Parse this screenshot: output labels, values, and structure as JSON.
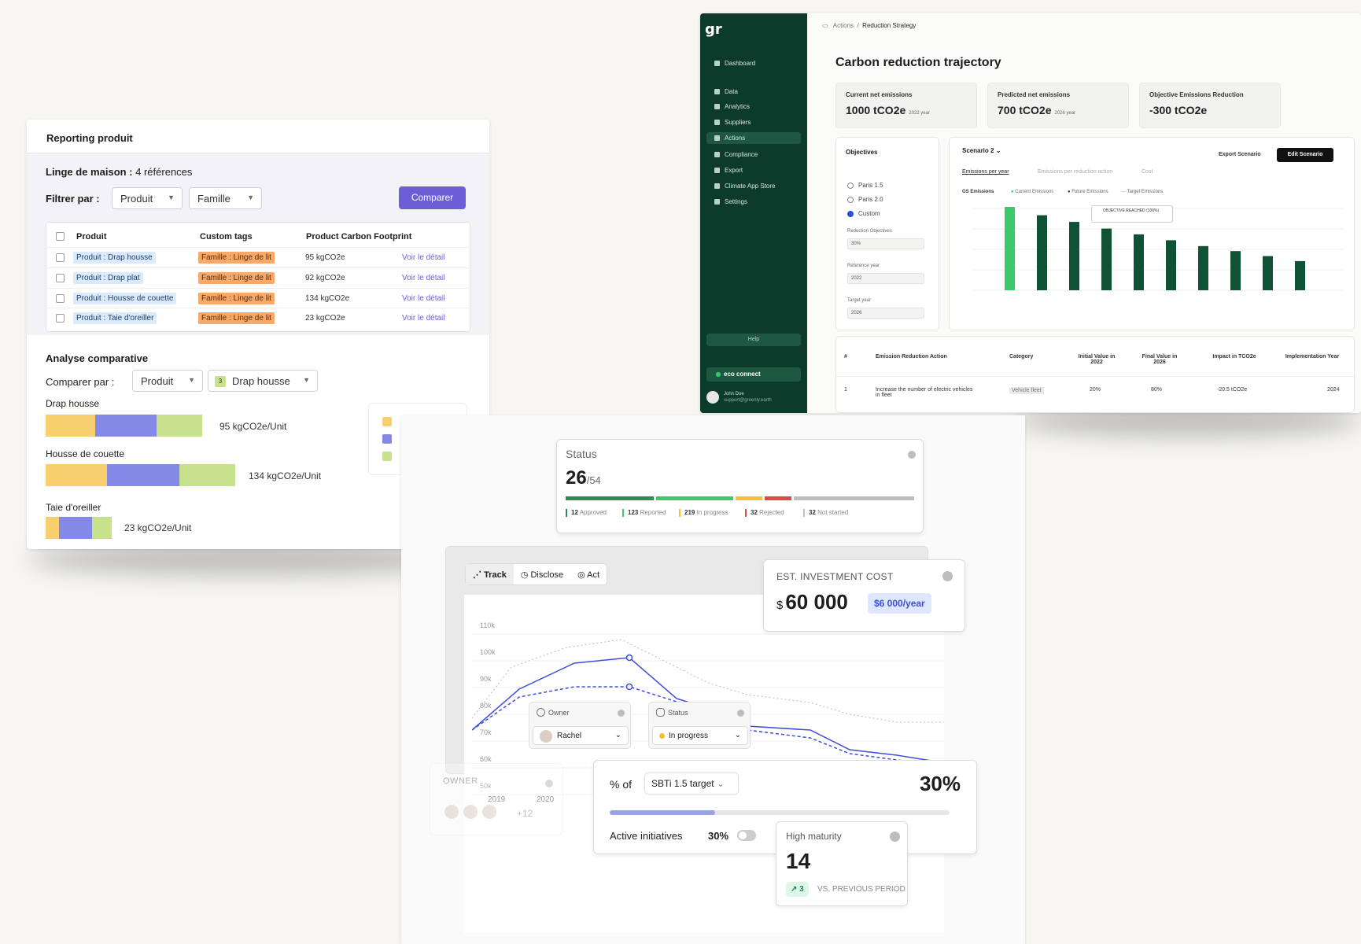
{
  "reporting": {
    "title": "Reporting produit",
    "category_label": "Linge de maison :",
    "category_count": "4 références",
    "filter_label": "Filtrer par :",
    "filter_product": "Produit",
    "filter_family": "Famille",
    "compare_button": "Comparer",
    "columns": [
      "Produit",
      "Custom tags",
      "Product Carbon Footprint"
    ],
    "rows": [
      {
        "product": "Produit : Drap housse",
        "tag": "Famille : Linge de lit",
        "footprint": "95 kgCO2e",
        "link": "Voir le détail"
      },
      {
        "product": "Produit : Drap plat",
        "tag": "Famille : Linge de lit",
        "footprint": "92 kgCO2e",
        "link": "Voir le détail"
      },
      {
        "product": "Produit : Housse de couette",
        "tag": "Famille : Linge de lit",
        "footprint": "134 kgCO2e",
        "link": "Voir le détail"
      },
      {
        "product": "Produit : Taie d'oreiller",
        "tag": "Famille : Linge de lit",
        "footprint": "23 kgCO2e",
        "link": "Voir le détail"
      }
    ],
    "analysis_title": "Analyse comparative",
    "compare_by_label": "Comparer par :",
    "compare_by_value": "Produit",
    "compare_item_badge": "3",
    "compare_item_value": "Drap housse",
    "bars": [
      {
        "label": "Drap housse",
        "value": "95 kgCO2e/Unit",
        "segments": [
          30,
          37,
          28
        ]
      },
      {
        "label": "Housse de couette",
        "value": "134 kgCO2e/Unit",
        "segments": [
          37,
          44,
          34
        ]
      },
      {
        "label": "Taie d'oreiller",
        "value": "23 kgCO2e/Unit",
        "segments": [
          8,
          20,
          12
        ]
      }
    ],
    "colors": {
      "yellow": "#f7cf6e",
      "blue": "#8389e4",
      "green": "#c7e18c",
      "purple": "#6c5ed6"
    }
  },
  "trajectory": {
    "breadcrumb": [
      "Actions",
      "/",
      "Reduction Strategy"
    ],
    "title": "Carbon reduction trajectory",
    "nav": [
      "Dashboard",
      "Data",
      "Analytics",
      "Suppliers",
      "Actions",
      "Compliance",
      "Export",
      "Climate App Store",
      "Settings"
    ],
    "help": "Help",
    "ecoconnect": "eco connect",
    "user_name": "John Doe",
    "user_email": "support@greenly.earth",
    "kpis": [
      {
        "label": "Current net emissions",
        "value": "1000 tCO2e",
        "sub": "2022 year"
      },
      {
        "label": "Predicted net emissions",
        "value": "700 tCO2e",
        "sub": "2026 year"
      },
      {
        "label": "Objective Emissions Reduction",
        "value": "-300 tCO2e",
        "sub": ""
      }
    ],
    "objectives_title": "Objectives",
    "objective_options": [
      "Paris 1.5",
      "Paris 2.0",
      "Custom"
    ],
    "field_labels": [
      "Reduction Objectives",
      "Reference year",
      "Target year"
    ],
    "field_values": [
      "30%",
      "2022",
      "2026"
    ],
    "scenario": "Scenario 2",
    "export_label": "Export Scenario",
    "edit_label": "Edit Scenario",
    "tabs": [
      "Emissions per year",
      "Emissions per reduction action",
      "Cost"
    ],
    "legend": [
      "GS Emissions",
      "Current Emissions",
      "Future Emissions",
      "Target Emissions"
    ],
    "tooltip": "OBJECTIVE REACHED (100%)",
    "table_headers": [
      "#",
      "Emission Reduction Action",
      "Category",
      "Initial Value in 2022",
      "Final Value in 2026",
      "Impact in TCO2e",
      "Implementation Year"
    ],
    "table_row": [
      "1",
      "Increase the number of electric vehicles in fleet",
      "Vehicle fleet",
      "20%",
      "80%",
      "-20.5 tCO2e",
      "2024"
    ],
    "bar_data": {
      "values": [
        100,
        90,
        82,
        74,
        67,
        60,
        53,
        47,
        41,
        35
      ],
      "first_color": "#3cc96b",
      "color": "#0f5236"
    }
  },
  "track": {
    "status_title": "Status",
    "status_value": "26",
    "status_total": "/54",
    "status_segments": [
      {
        "n": "12",
        "label": "Approved",
        "color": "#2e8b57",
        "w": 25
      },
      {
        "n": "123",
        "label": "Reported",
        "color": "#3cc96b",
        "w": 22
      },
      {
        "n": "219",
        "label": "In progress",
        "color": "#f2c230",
        "w": 8
      },
      {
        "n": "32",
        "label": "Rejected",
        "color": "#e04848",
        "w": 8
      },
      {
        "n": "32",
        "label": "Not started",
        "color": "#bdbdbd",
        "w": 34
      }
    ],
    "tabs": [
      "Track",
      "Disclose",
      "Act"
    ],
    "invest_title": "EST. INVESTMENT COST",
    "invest_currency": "$",
    "invest_value": "60 000",
    "invest_pill": "$6 000/year",
    "y_ticks": [
      "110k",
      "100k",
      "90k",
      "80k",
      "70k",
      "60k",
      "50k"
    ],
    "x_ticks": [
      "2019",
      "2020"
    ],
    "owner_label": "Owner",
    "owner_value": "Rachel",
    "status_label": "Status",
    "status_value_dd": "In progress",
    "sbti_prefix": "% of",
    "sbti_target": "SBTi 1.5 target",
    "sbti_pct": "30%",
    "sbti_progress": 0.31,
    "active_label": "Active initiatives",
    "active_value": "30%",
    "maturity_title": "High maturity",
    "maturity_value": "14",
    "maturity_delta": "3",
    "maturity_vs": "VS. PREVIOUS PERIOD",
    "ghost_owner": "OWNER",
    "ghost_more": "+12",
    "line_color": "#3b4fd8"
  }
}
